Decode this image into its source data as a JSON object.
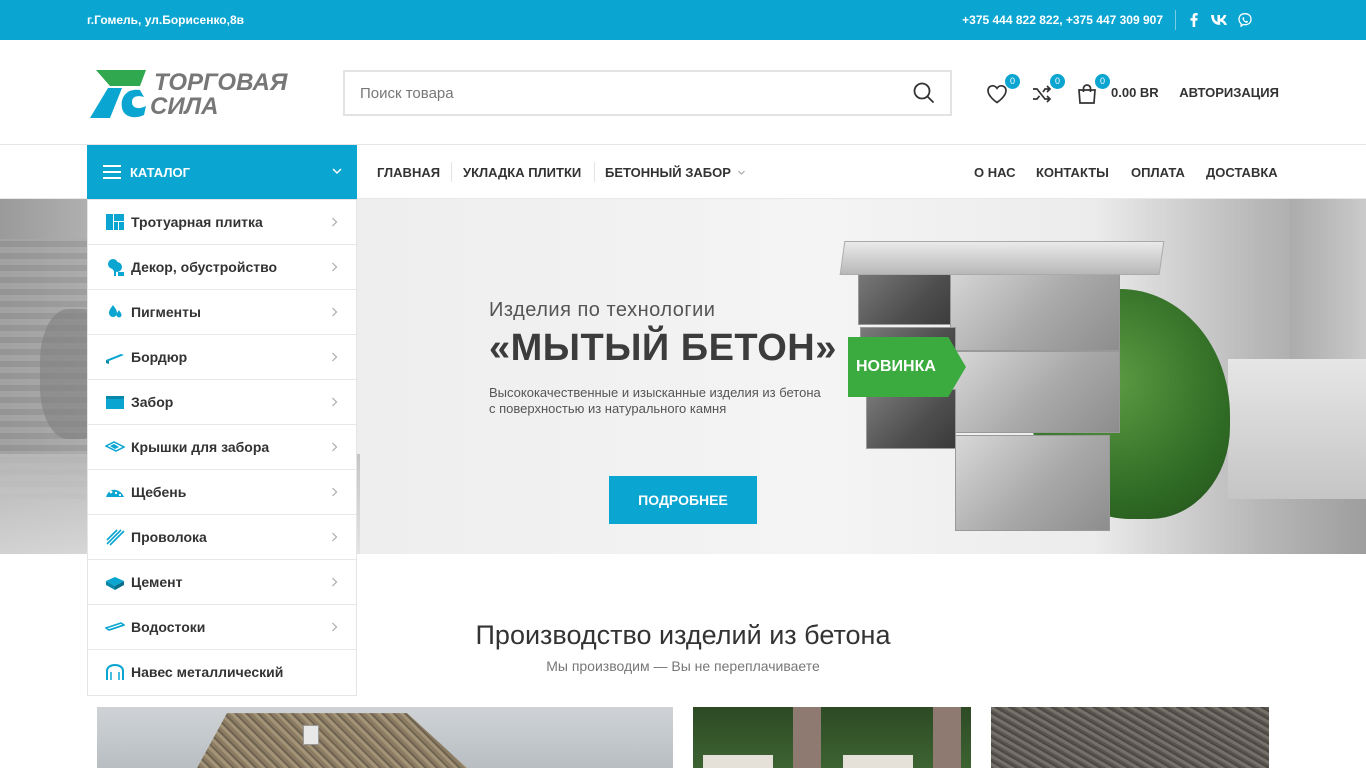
{
  "topbar": {
    "address": "г.Гомель, ул.Борисенко,8в",
    "phones": "+375 444 822 822, +375 447 309 907",
    "social": [
      {
        "name": "facebook-icon",
        "glyph": "f"
      },
      {
        "name": "vk-icon",
        "glyph": "vk"
      },
      {
        "name": "viber-icon",
        "glyph": "viber"
      }
    ]
  },
  "header": {
    "logo_line1": "ТОРГОВАЯ",
    "logo_line2": "СИЛА",
    "search_placeholder": "Поиск товара",
    "wishlist_count": "0",
    "compare_count": "0",
    "cart_count": "0",
    "cart_total": "0.00 BR",
    "auth_label": "АВТОРИЗАЦИЯ"
  },
  "nav": {
    "catalog_label": "КАТАЛОГ",
    "left_items": [
      "ГЛАВНАЯ",
      "УКЛАДКА ПЛИТКИ",
      "БЕТОННЫЙ ЗАБОР"
    ],
    "right_items": [
      "О НАС",
      "КОНТАКТЫ",
      "ОПЛАТА",
      "ДОСТАВКА"
    ]
  },
  "hero": {
    "subtitle": "Изделия по технологии",
    "title": "«МЫТЫЙ БЕТОН»",
    "description": "Высококачественные и изысканные изделия из бетона с поверхностью из натурального камня",
    "badge": "НОВИНКА",
    "button": "ПОДРОБНЕЕ"
  },
  "catalog": [
    {
      "label": "Тротуарная плитка",
      "icon": "paving-tile-icon"
    },
    {
      "label": "Декор, обустройство",
      "icon": "tree-icon"
    },
    {
      "label": "Пигменты",
      "icon": "pigment-drops-icon"
    },
    {
      "label": "Бордюр",
      "icon": "curb-icon"
    },
    {
      "label": "Забор",
      "icon": "fence-icon"
    },
    {
      "label": "Крышки для забора",
      "icon": "fence-cap-icon"
    },
    {
      "label": "Щебень",
      "icon": "gravel-icon"
    },
    {
      "label": "Проволока",
      "icon": "wire-icon"
    },
    {
      "label": "Цемент",
      "icon": "cement-icon"
    },
    {
      "label": "Водостоки",
      "icon": "drain-icon"
    },
    {
      "label": "Навес металлический",
      "icon": "canopy-icon"
    }
  ],
  "section": {
    "title": "Производство изделий из бетона",
    "subtitle": "Мы производим — Вы не переплачиваете"
  },
  "colors": {
    "accent": "#0aa5d0",
    "badge_green": "#3bab3f",
    "logo_green": "#2fa84f"
  }
}
